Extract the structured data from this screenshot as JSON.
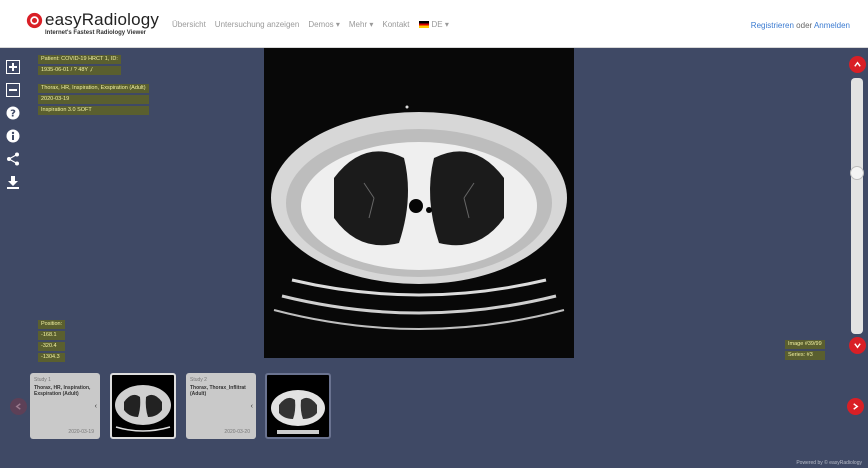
{
  "header": {
    "logo_title": "easyRadiology",
    "logo_subtitle": "Internet's Fastest Radiology Viewer",
    "nav": [
      "Übersicht",
      "Untersuchung anzeigen",
      "Demos ▾",
      "Mehr ▾",
      "Kontakt",
      "DE ▾"
    ],
    "register": "Registrieren",
    "or": "oder",
    "login": "Anmelden"
  },
  "toolbar": {
    "icons": [
      "zoom-in-icon",
      "zoom-out-icon",
      "help-icon",
      "info-icon",
      "share-icon",
      "download-icon"
    ]
  },
  "overlay": {
    "patient_lines": [
      "Patient: COVID-19 HRCT 1, ID:",
      "1935-06-01 / ? 48Y ,/"
    ],
    "study_lines": [
      "Thorax, HR, Inspiration, Exspiration (Adult)",
      "2020-03-19",
      "Inspiration 3.0 SOFT"
    ],
    "position_lines": [
      "Position:",
      "-168.1",
      "-320.4",
      "-1304.3"
    ],
    "image_lines": [
      "Image #39/99",
      "Series: #3"
    ]
  },
  "studies": [
    {
      "label": "Study 1",
      "desc": "Thorax, HR, Inspiration, Exspiration (Adult)",
      "date": "2020-03-19"
    },
    {
      "label": "Study 2",
      "desc": "Thorax, Thorax_Inflitrat (Adult)",
      "date": "2020-03-20"
    }
  ],
  "footer": "Powered by © easyRadiology",
  "colors": {
    "accent": "#d91f26",
    "background": "#3f4965",
    "overlay_text": "#f1f1a2",
    "link": "#3b7bd1"
  }
}
